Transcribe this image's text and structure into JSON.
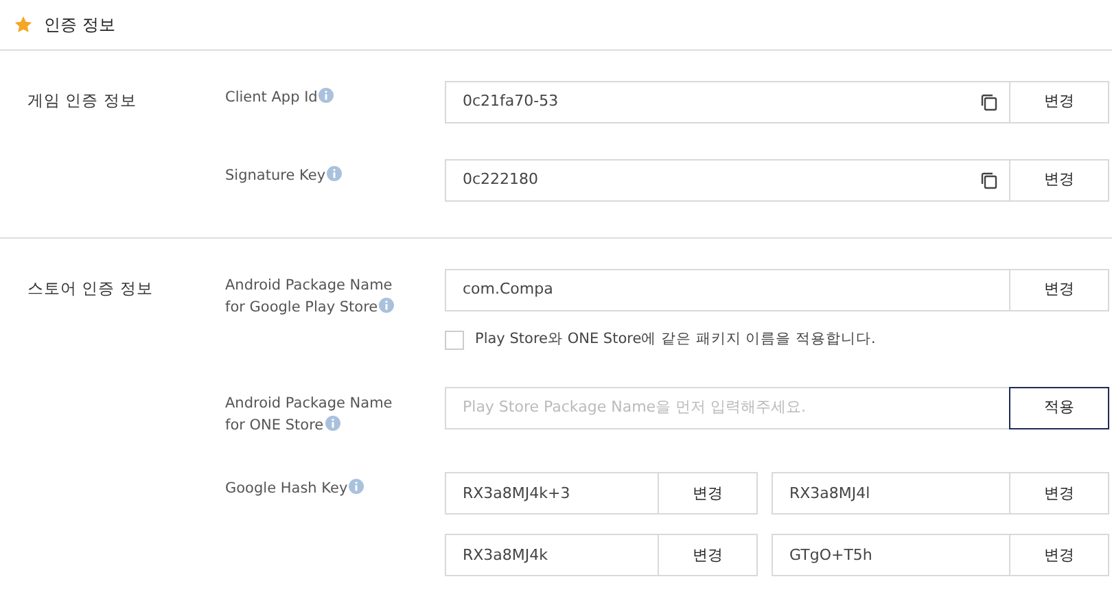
{
  "header": {
    "title": "인증 정보"
  },
  "sections": [
    {
      "title": "게임 인증 정보",
      "rows": [
        {
          "label": "Client App Id",
          "inputs": [
            {
              "value": "0c21fa70-53",
              "copyable": true,
              "button": "변경",
              "kind": "change"
            }
          ]
        },
        {
          "label": "Signature Key",
          "inputs": [
            {
              "value": "0c222180",
              "copyable": true,
              "button": "변경",
              "kind": "change"
            }
          ]
        }
      ]
    },
    {
      "title": "스토어 인증 정보",
      "rows": [
        {
          "label": "Android Package Name\nfor Google Play Store",
          "inputs": [
            {
              "value": "com.Compa",
              "copyable": false,
              "button": "변경",
              "kind": "change"
            }
          ],
          "checkbox": {
            "label": "Play Store와 ONE Store에 같은 패키지 이름을 적용합니다.",
            "checked": false
          }
        },
        {
          "label": "Android Package Name\nfor ONE Store",
          "inputs": [
            {
              "placeholder": "Play Store Package Name을 먼저 입력해주세요.",
              "copyable": false,
              "button": "적용",
              "kind": "apply"
            }
          ]
        },
        {
          "label": "Google Hash Key",
          "inputs": [
            {
              "value": "RX3a8MJ4k+3",
              "copyable": false,
              "button": "변경",
              "kind": "change"
            },
            {
              "value": "RX3a8MJ4l",
              "copyable": false,
              "button": "변경",
              "kind": "change"
            },
            {
              "value": "RX3a8MJ4k",
              "copyable": false,
              "button": "변경",
              "kind": "change"
            },
            {
              "value": "GTgO+T5h",
              "copyable": false,
              "button": "변경",
              "kind": "change"
            }
          ]
        }
      ]
    }
  ]
}
